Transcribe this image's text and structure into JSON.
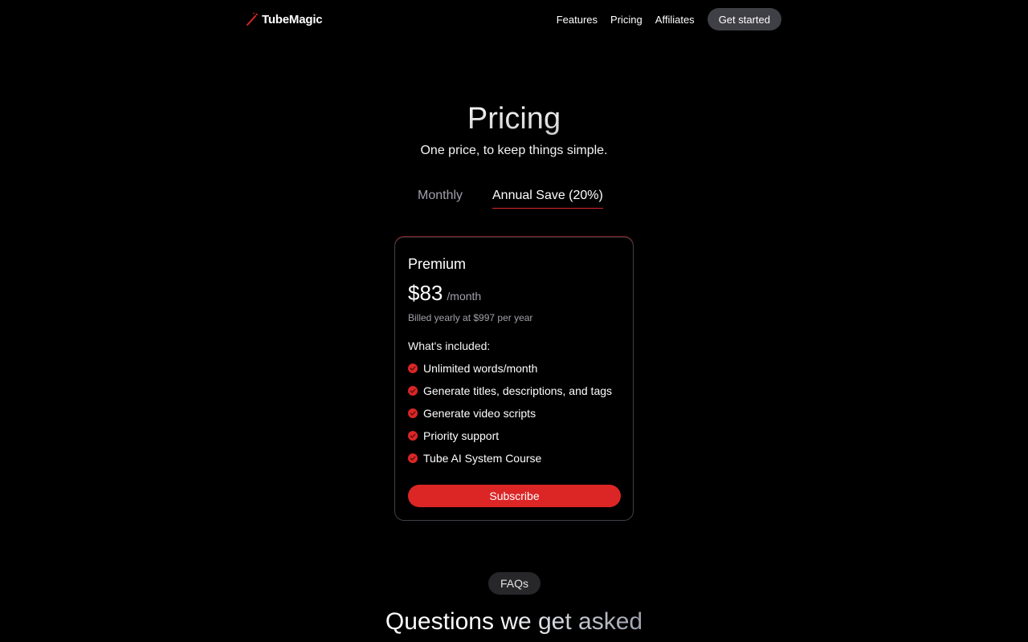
{
  "brand": {
    "name": "TubeMagic",
    "icon": "magic-wand-icon",
    "accent_color": "#dc2626"
  },
  "nav": {
    "links": [
      "Features",
      "Pricing",
      "Affiliates"
    ],
    "cta_label": "Get started"
  },
  "hero": {
    "title": "Pricing",
    "subtitle": "One price, to keep things simple."
  },
  "billing_toggle": {
    "monthly_label": "Monthly",
    "annual_label": "Annual Save (20%)",
    "selected": "annual"
  },
  "plan": {
    "name": "Premium",
    "price": "$83",
    "period": "/month",
    "billing_note": "Billed yearly at $997 per year",
    "included_label": "What's included:",
    "feature_icon": "check-circle-icon",
    "features": [
      "Unlimited words/month",
      "Generate titles, descriptions, and tags",
      "Generate video scripts",
      "Priority support",
      "Tube AI System Course"
    ],
    "subscribe_label": "Subscribe"
  },
  "faq": {
    "badge": "FAQs",
    "title": "Questions we get asked"
  }
}
